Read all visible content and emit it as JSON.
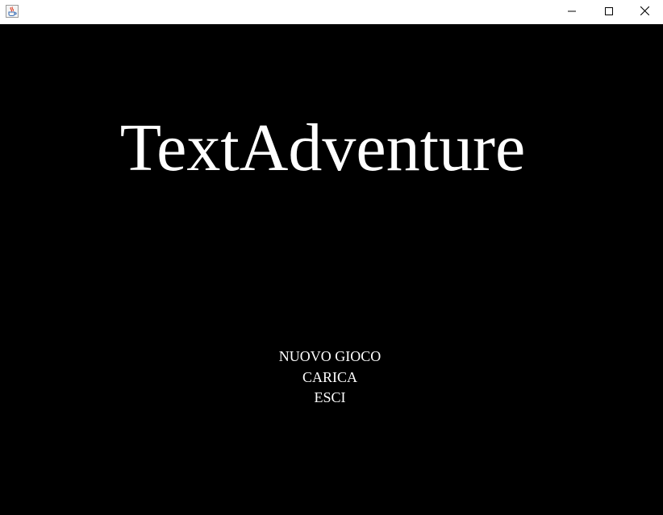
{
  "window": {
    "title": "",
    "icon": "java-coffee-cup-icon",
    "controls": {
      "minimize_icon": "minimize-icon",
      "maximize_icon": "maximize-icon",
      "close_icon": "close-icon"
    }
  },
  "game": {
    "title": "TextAdventure",
    "menu": [
      {
        "label": "NUOVO GIOCO"
      },
      {
        "label": "CARICA"
      },
      {
        "label": "ESCI"
      }
    ]
  },
  "colors": {
    "background": "#000000",
    "text": "#ffffff",
    "titlebar": "#ffffff"
  }
}
